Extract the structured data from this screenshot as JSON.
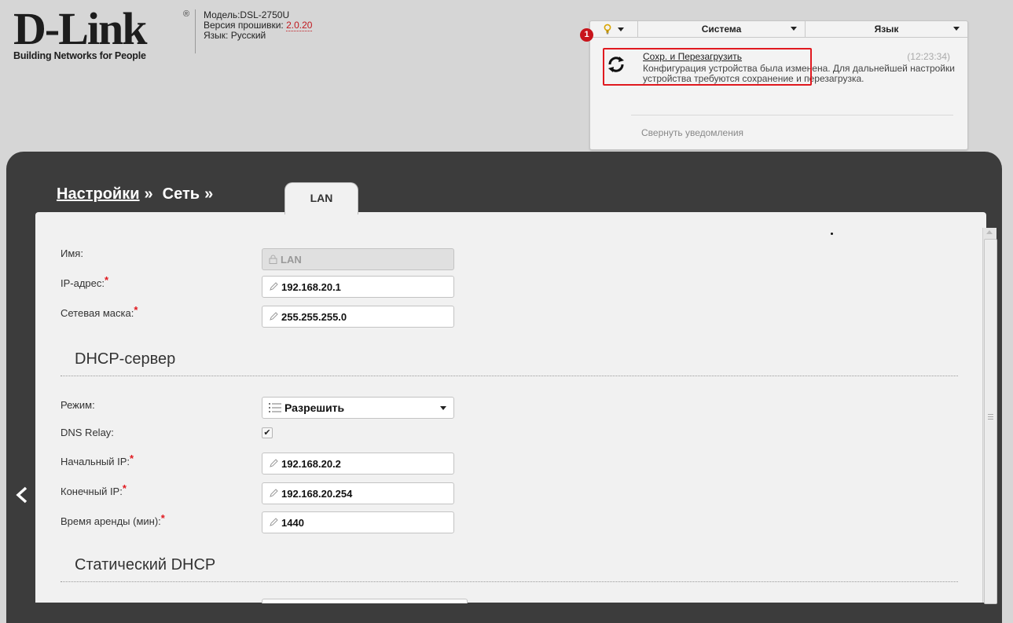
{
  "header": {
    "logo": "D-Link",
    "logo_registered": "®",
    "tagline": "Building Networks for People",
    "model_label": "Модель:",
    "model_value": "DSL-2750U",
    "firmware_label": "Версия прошивки:",
    "firmware_value": "2.0.20",
    "language_label": "Язык:",
    "language_value": "Русский"
  },
  "topmenu": {
    "system_label": "Система",
    "language_label": "Язык",
    "badge_count": "1"
  },
  "notification": {
    "link": "Сохр. и Перезагрузить",
    "time": "(12:23:34)",
    "text": "Конфигурация устройства была изменена. Для дальнейшей настройки устройства требуются сохранение и перезагрузка.",
    "collapse": "Свернуть уведомления"
  },
  "breadcrumb": {
    "settings": "Настройки",
    "sep1": "»",
    "network": "Сеть",
    "sep2": "»",
    "current_tab": "LAN"
  },
  "form": {
    "name": {
      "label": "Имя:",
      "value": "LAN"
    },
    "ip": {
      "label": "IP-адрес:",
      "value": "192.168.20.1"
    },
    "mask": {
      "label": "Сетевая маска:",
      "value": "255.255.255.0"
    },
    "required_mark": "*"
  },
  "dhcp": {
    "title": "DHCP-сервер",
    "mode": {
      "label": "Режим:",
      "value": "Разрешить"
    },
    "dns_relay": {
      "label": "DNS Relay:",
      "checked": true,
      "mark": "✔"
    },
    "start_ip": {
      "label": "Начальный IP:",
      "value": "192.168.20.2"
    },
    "end_ip": {
      "label": "Конечный IP:",
      "value": "192.168.20.254"
    },
    "lease": {
      "label": "Время аренды (мин):",
      "value": "1440"
    }
  },
  "static_dhcp": {
    "title": "Статический DHCP"
  },
  "colors": {
    "accent_red": "#e0191f",
    "frame_dark": "#3c3c3c",
    "content_bg": "#f1f1f1"
  }
}
